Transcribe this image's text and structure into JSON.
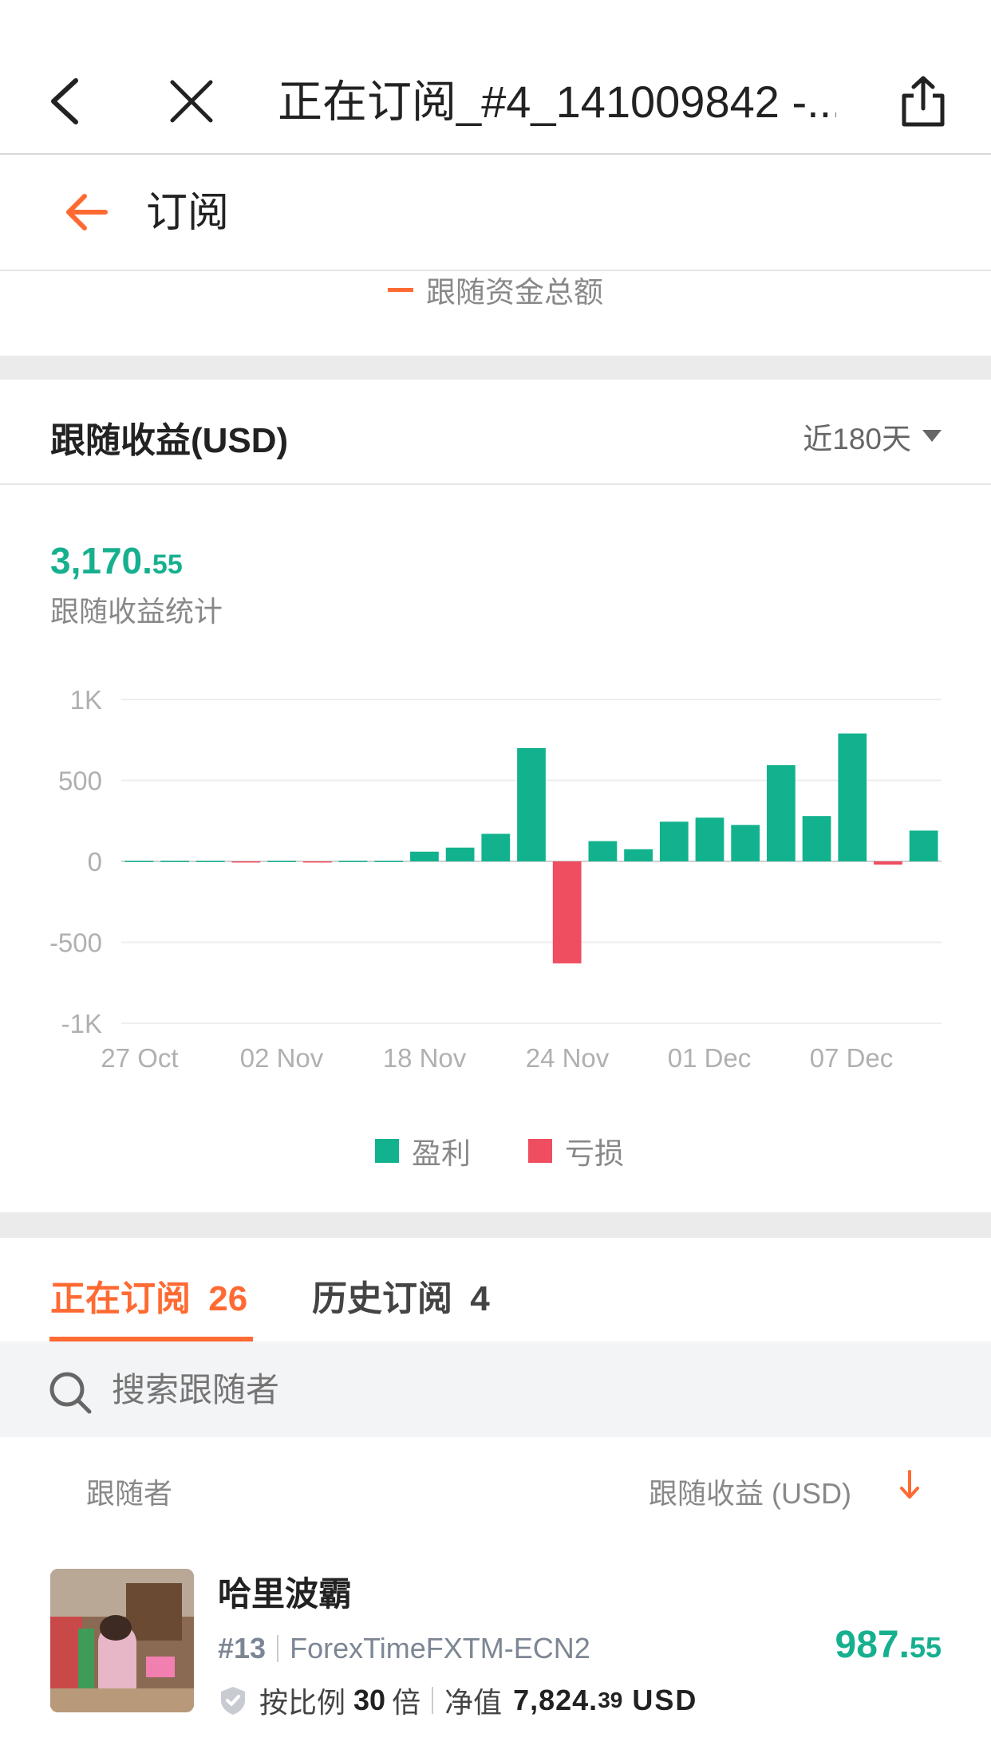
{
  "nav": {
    "title": "正在订阅_#4_141009842 -...",
    "back_icon": "chevron-left-icon",
    "close_icon": "close-icon",
    "share_icon": "share-icon"
  },
  "header": {
    "title": "订阅",
    "back_icon": "arrow-left-icon",
    "accent": "#ff6a33"
  },
  "top_legend": {
    "label": "跟随资金总额"
  },
  "earnings": {
    "title": "跟随收益(USD)",
    "range": "近180天",
    "total_int": "3,170.",
    "total_dec": "55",
    "total_label": "跟随收益统计",
    "legend_profit": "盈利",
    "legend_loss": "亏损",
    "profit_color": "#12b28e",
    "loss_color": "#ee4e5f"
  },
  "chart_data": {
    "type": "bar",
    "y_ticks": [
      "1K",
      "500",
      "0",
      "-500",
      "-1K"
    ],
    "ylim": [
      -1000,
      1000
    ],
    "x_ticks": [
      "27 Oct",
      "02 Nov",
      "18 Nov",
      "24 Nov",
      "01 Dec",
      "07 Dec"
    ],
    "series": [
      {
        "name": "盈利",
        "color": "#12b28e"
      },
      {
        "name": "亏损",
        "color": "#ee4e5f"
      }
    ],
    "values": [
      3,
      3,
      3,
      -3,
      3,
      -6,
      3,
      3,
      60,
      85,
      170,
      700,
      -630,
      125,
      75,
      245,
      270,
      225,
      595,
      280,
      790,
      -20,
      190
    ]
  },
  "tabs": [
    {
      "label": "正在订阅",
      "count": "26"
    },
    {
      "label": "历史订阅",
      "count": "4"
    }
  ],
  "search": {
    "placeholder": "搜索跟随者",
    "icon": "search-icon"
  },
  "list_header": {
    "col1": "跟随者",
    "col2": "跟随收益 (USD)",
    "sort_icon": "arrow-down-icon"
  },
  "list": [
    {
      "name": "哈里波霸",
      "id": "#13",
      "server": "ForexTimeFXTM-ECN2",
      "ratio_label": "按比例",
      "ratio_value": "30",
      "ratio_unit": "倍",
      "equity_label": "净值",
      "equity_int": "7,824.",
      "equity_dec": "39",
      "equity_unit": "USD",
      "profit_int": "987.",
      "profit_dec": "55"
    }
  ]
}
